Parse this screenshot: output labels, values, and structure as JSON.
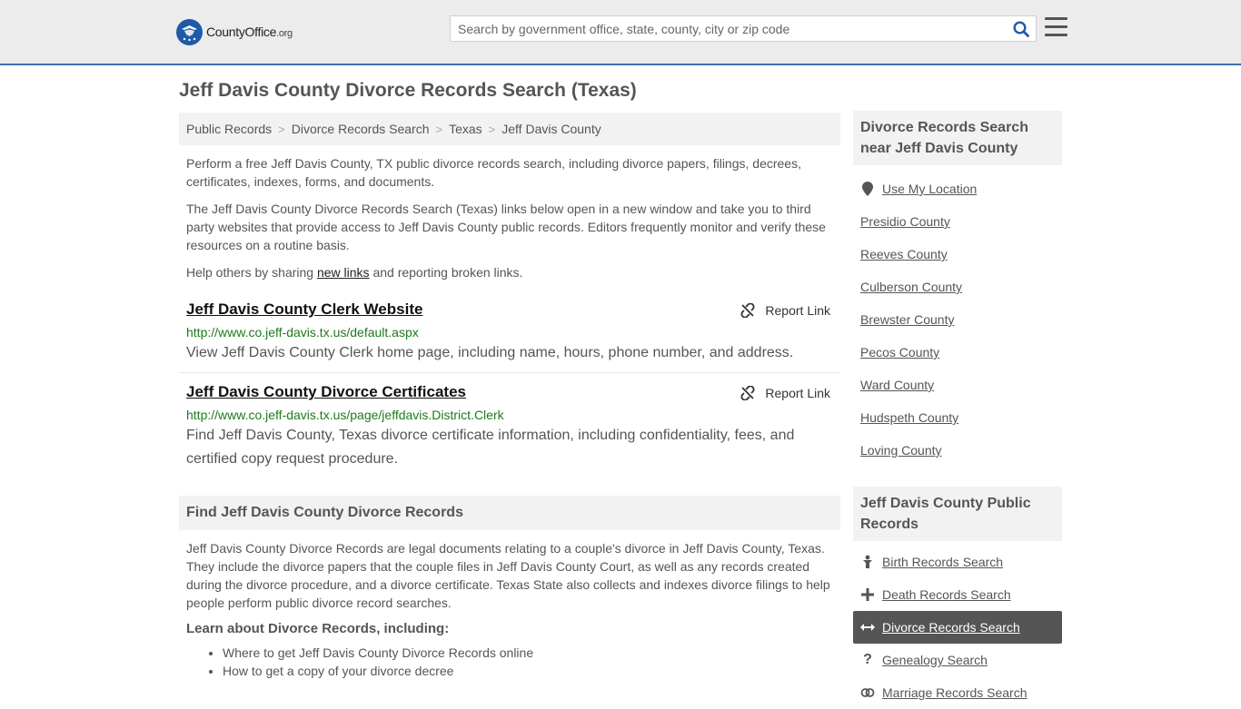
{
  "header": {
    "logo_name": "CountyOffice",
    "logo_tld": ".org",
    "search_placeholder": "Search by government office, state, county, city or zip code"
  },
  "page": {
    "title": "Jeff Davis County Divorce Records Search (Texas)"
  },
  "breadcrumb": [
    "Public Records",
    "Divorce Records Search",
    "Texas",
    "Jeff Davis County"
  ],
  "intro": {
    "p1": "Perform a free Jeff Davis County, TX public divorce records search, including divorce papers, filings, decrees, certificates, indexes, forms, and documents.",
    "p2": "The Jeff Davis County Divorce Records Search (Texas) links below open in a new window and take you to third party websites that provide access to Jeff Davis County public records. Editors frequently monitor and verify these resources on a routine basis.",
    "p3_before": "Help others by sharing ",
    "p3_link": "new links",
    "p3_after": " and reporting broken links."
  },
  "links": [
    {
      "title": "Jeff Davis County Clerk Website",
      "url": "http://www.co.jeff-davis.tx.us/default.aspx",
      "desc": "View Jeff Davis County Clerk home page, including name, hours, phone number, and address.",
      "report": "Report Link"
    },
    {
      "title": "Jeff Davis County Divorce Certificates",
      "url": "http://www.co.jeff-davis.tx.us/page/jeffdavis.District.Clerk",
      "desc": "Find Jeff Davis County, Texas divorce certificate information, including confidentiality, fees, and certified copy request procedure.",
      "report": "Report Link"
    }
  ],
  "find_section": {
    "heading": "Find Jeff Davis County Divorce Records",
    "body": "Jeff Davis County Divorce Records are legal documents relating to a couple's divorce in Jeff Davis County, Texas. They include the divorce papers that the couple files in Jeff Davis County Court, as well as any records created during the divorce procedure, and a divorce certificate. Texas State also collects and indexes divorce filings to help people perform public divorce record searches.",
    "learn_heading": "Learn about Divorce Records, including:",
    "bullets": [
      "Where to get Jeff Davis County Divorce Records online",
      "How to get a copy of your divorce decree"
    ]
  },
  "sidebar": {
    "nearby_heading": "Divorce Records Search near Jeff Davis County",
    "use_location": "Use My Location",
    "nearby": [
      "Presidio County",
      "Reeves County",
      "Culberson County",
      "Brewster County",
      "Pecos County",
      "Ward County",
      "Hudspeth County",
      "Loving County"
    ],
    "public_heading": "Jeff Davis County Public Records",
    "records": [
      {
        "label": "Birth Records Search",
        "icon": "baby-icon",
        "active": false
      },
      {
        "label": "Death Records Search",
        "icon": "cross-icon",
        "active": false
      },
      {
        "label": "Divorce Records Search",
        "icon": "double-arrow-icon",
        "active": true
      },
      {
        "label": "Genealogy Search",
        "icon": "question-icon",
        "active": false
      },
      {
        "label": "Marriage Records Search",
        "icon": "rings-icon",
        "active": false
      }
    ]
  },
  "colors": {
    "accent_border": "#3f6fb0",
    "url_green": "#1d7a1d",
    "active_bg": "#555555"
  }
}
